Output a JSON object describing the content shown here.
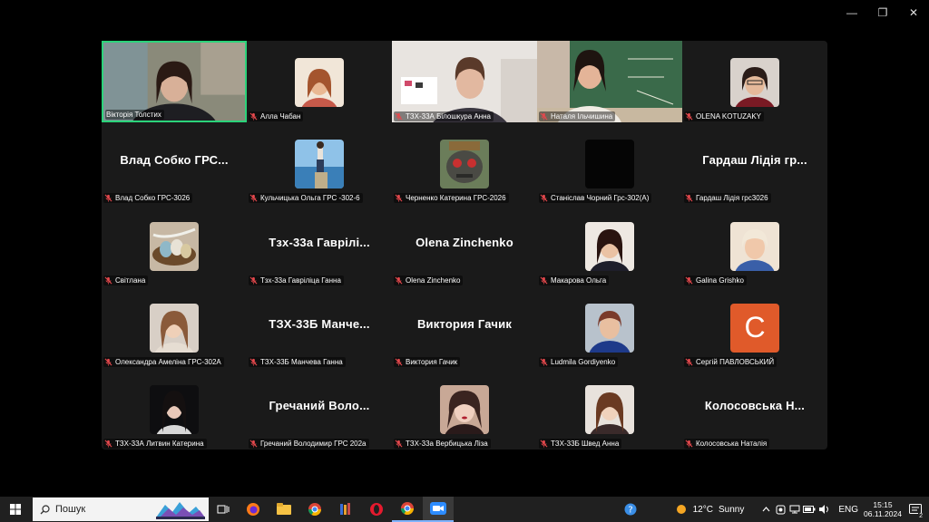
{
  "window": {
    "minimize": "—",
    "restore": "❐",
    "close": "✕"
  },
  "tiles": [
    {
      "kind": "video",
      "name": "Вікторія Толстих",
      "muted": false,
      "active": true,
      "scene": "woman-room"
    },
    {
      "kind": "avatar",
      "name": "Алла Чабан",
      "muted": true,
      "photo": "portrait-warm"
    },
    {
      "kind": "video",
      "name": "ТЗХ-33А Білошкура Анна",
      "muted": true,
      "scene": "girl-room"
    },
    {
      "kind": "video",
      "name": "Наталя Ільчишина",
      "muted": true,
      "scene": "woman-board"
    },
    {
      "kind": "avatar",
      "name": "OLENA KOTUZAKY",
      "muted": true,
      "photo": "portrait-red"
    },
    {
      "kind": "text",
      "big": "Влад Собко ГРС...",
      "name": "Влад Собко ГРС-3026",
      "muted": true
    },
    {
      "kind": "avatar",
      "name": "Кульчицька Ольга ГРС -302-6",
      "muted": true,
      "photo": "sea"
    },
    {
      "kind": "avatar",
      "name": "Черненко Катерина ГРС-2026",
      "muted": true,
      "photo": "creature"
    },
    {
      "kind": "avatar",
      "name": "Станіслав Чорний Грс-302(А)",
      "muted": true,
      "photo": "black"
    },
    {
      "kind": "text",
      "big": "Гардаш Лідія гр...",
      "name": "Гардаш Лідія грс3026",
      "muted": true
    },
    {
      "kind": "avatar",
      "name": "Світлана",
      "muted": true,
      "photo": "eggs"
    },
    {
      "kind": "text",
      "big": "Тзх-33а Гаврілі...",
      "name": "Тзх-33а Гавріліца Ганна",
      "muted": true
    },
    {
      "kind": "text",
      "big": "Olena Zinchenko",
      "name": "Olena Zinchenko",
      "muted": true
    },
    {
      "kind": "avatar",
      "name": "Макарова Ольга",
      "muted": true,
      "photo": "portrait-dark"
    },
    {
      "kind": "avatar",
      "name": "Galina Grishko",
      "muted": true,
      "photo": "portrait-light"
    },
    {
      "kind": "avatar",
      "name": "Олександра Амеліна ГРС-302А",
      "muted": true,
      "photo": "portrait-beige"
    },
    {
      "kind": "text",
      "big": "ТЗХ-33Б Манче...",
      "name": "ТЗХ-33Б Манчева Ганна",
      "muted": true
    },
    {
      "kind": "text",
      "big": "Виктория Гачик",
      "name": "Виктория Гачик",
      "muted": true
    },
    {
      "kind": "avatar",
      "name": "Ludmila Gordiyenko",
      "muted": true,
      "photo": "portrait-blue"
    },
    {
      "kind": "letter",
      "letter": "С",
      "name": "Сергій ПАВЛОВСЬКИЙ",
      "muted": true
    },
    {
      "kind": "avatar",
      "name": "ТЗХ-33А Литвин Катерина",
      "muted": true,
      "photo": "portrait-night"
    },
    {
      "kind": "text",
      "big": "Гречаний Воло...",
      "name": "Гречаний Володимир ГРС 202а",
      "muted": true
    },
    {
      "kind": "avatar",
      "name": "ТЗХ-33а Вербицька Ліза",
      "muted": true,
      "photo": "portrait-glam"
    },
    {
      "kind": "avatar",
      "name": "ТЗХ-33Б Швед Анна",
      "muted": true,
      "photo": "portrait-pale"
    },
    {
      "kind": "text",
      "big": "Колосовська Н...",
      "name": "Колосовська Наталія",
      "muted": true
    }
  ],
  "taskbar": {
    "search_placeholder": "Пошук",
    "weather_temp": "12°C",
    "weather_desc": "Sunny",
    "lang": "ENG",
    "time": "15:15",
    "date": "06.11.2024",
    "notif_count": "2"
  },
  "colors": {
    "active_border": "#2bd37a",
    "muted_mic": "#e5484d",
    "gallery_bg": "#1a1a1a",
    "taskbar_bg": "#202020"
  }
}
